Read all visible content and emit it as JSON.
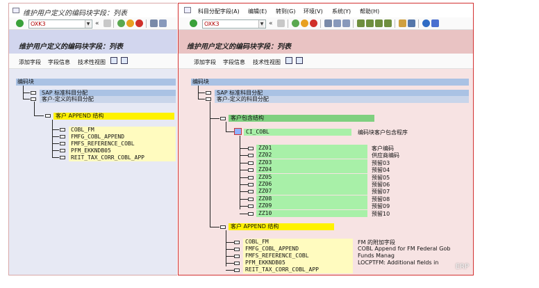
{
  "left": {
    "window_title": "维护用户定义的编码块字段：列表",
    "command": "OXK3",
    "heading": "维护用户定义的编码块字段：列表",
    "app_toolbar": [
      "添加字段",
      "字段信息",
      "技术性视图"
    ],
    "tree": {
      "root": "编码块",
      "sap_node": "SAP 标准科目分配",
      "customer_node": "客户-定义的科目分配",
      "append_node": "客户 APPEND 结构",
      "fields": [
        "COBL_FM",
        "FMFG_COBL_APPEND",
        "FMFS_REFERENCE_COBL",
        "PFM_EKKNDB05",
        "REIT_TAX_CORR_COBL_APP"
      ]
    }
  },
  "right": {
    "menu": [
      "科目分配字段(A)",
      "编辑(E)",
      "转到(G)",
      "环境(V)",
      "系统(Y)",
      "帮助(H)"
    ],
    "command": "OXK3",
    "heading": "维护用户定义的编码块字段：列表",
    "app_toolbar": [
      "添加字段",
      "字段信息",
      "技术性视图"
    ],
    "tree": {
      "root": "编码块",
      "sap_node": "SAP 标准科目分配",
      "customer_node": "客户-定义的科目分配",
      "include_node": "客户包含结构",
      "ci_node": "CI_COBL",
      "ci_desc": "编码块客户包含程序",
      "zz_fields": [
        {
          "name": "ZZ01",
          "desc": "客户编码"
        },
        {
          "name": "ZZ02",
          "desc": "供应商编码"
        },
        {
          "name": "ZZ03",
          "desc": "预留03"
        },
        {
          "name": "ZZ04",
          "desc": "预留04"
        },
        {
          "name": "ZZ05",
          "desc": "预留05"
        },
        {
          "name": "ZZ06",
          "desc": "预留06"
        },
        {
          "name": "ZZ07",
          "desc": "预留07"
        },
        {
          "name": "ZZ08",
          "desc": "预留08"
        },
        {
          "name": "ZZ09",
          "desc": "预留09"
        },
        {
          "name": "ZZ10",
          "desc": "预留10"
        }
      ],
      "append_node": "客户 APPEND 结构",
      "append_fields": [
        {
          "name": "COBL_FM",
          "desc": "FM 的附加字段"
        },
        {
          "name": "FMFG_COBL_APPEND",
          "desc": "COBL Append for FM Federal Gob"
        },
        {
          "name": "FMFS_REFERENCE_COBL",
          "desc": "Funds Manag"
        },
        {
          "name": "PFM_EKKNDB05",
          "desc": "LOCPTFM: Additional fields in"
        },
        {
          "name": "REIT_TAX_CORR_COBL_APP",
          "desc": ""
        }
      ]
    },
    "watermark": "ERP"
  },
  "colors": {
    "left_bg": "#e7e9f4",
    "right_bg": "#f7e3e3",
    "highlight_blue": "#aac2e4",
    "highlight_yellow": "#fff200",
    "highlight_green": "#7fd07f",
    "frame_red": "#d32f2f"
  }
}
